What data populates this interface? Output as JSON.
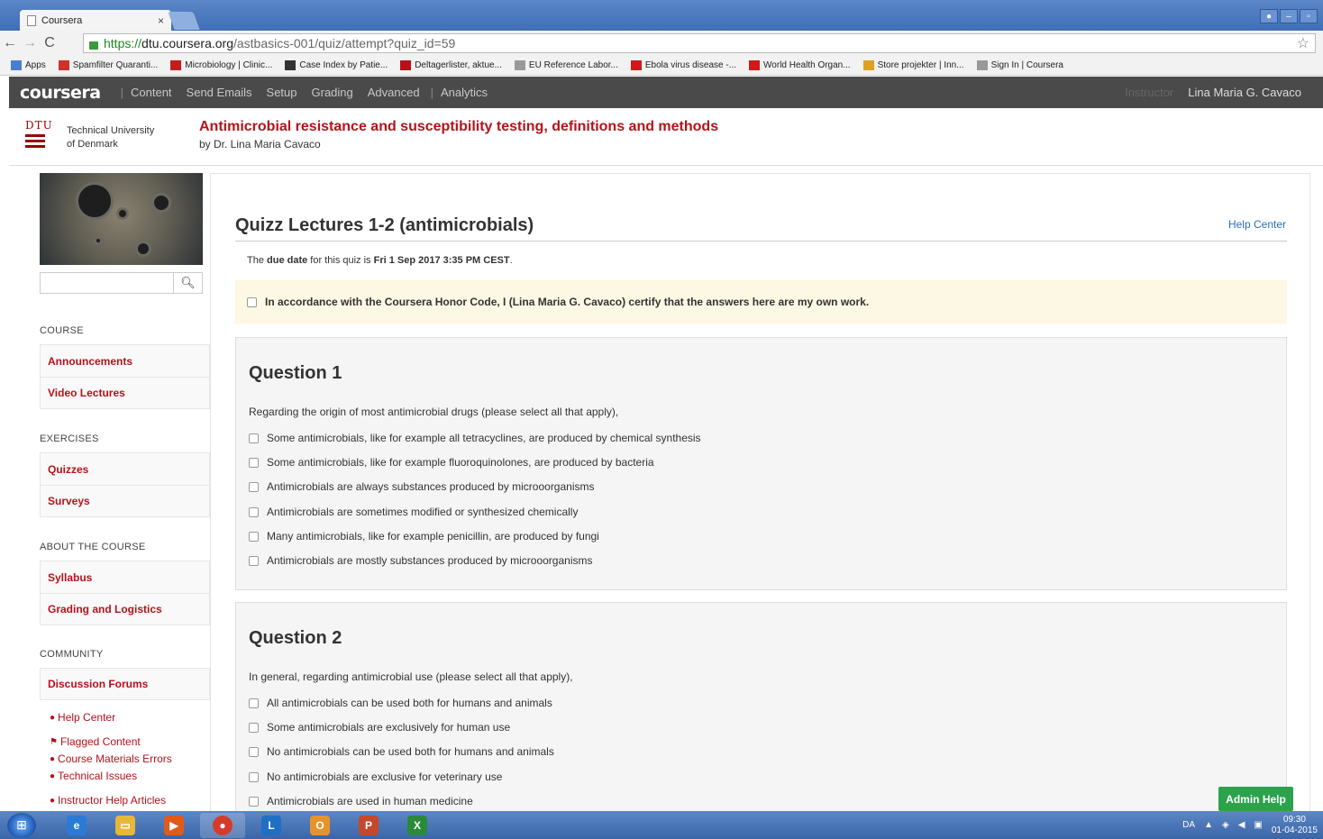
{
  "browser": {
    "tab_title": "Coursera",
    "tab_close": "×",
    "url_protocol": "https://",
    "url_host": "dtu.coursera.org",
    "url_path": "/astbasics-001/quiz/attempt?quiz_id=59",
    "bookmarks": [
      {
        "label": "Apps",
        "color": "#4a7fd0"
      },
      {
        "label": "Spamfilter Quaranti...",
        "color": "#d0302a"
      },
      {
        "label": "Microbiology | Clinic...",
        "color": "#c41d1d"
      },
      {
        "label": "Case Index by Patie...",
        "color": "#333333"
      },
      {
        "label": "Deltagerlister, aktue...",
        "color": "#b5121b"
      },
      {
        "label": "EU Reference Labor...",
        "color": "#999999"
      },
      {
        "label": "Ebola virus disease -...",
        "color": "#d01a1a"
      },
      {
        "label": "World Health Organ...",
        "color": "#d01a1a"
      },
      {
        "label": "Store projekter | Inn...",
        "color": "#e0a020"
      },
      {
        "label": "Sign In | Coursera",
        "color": "#999999"
      }
    ]
  },
  "nav": {
    "logo": "coursera",
    "sep": "|",
    "links": [
      "Content",
      "Send Emails",
      "Setup",
      "Grading",
      "Advanced"
    ],
    "analytics": "Analytics",
    "role": "Instructor",
    "user": "Lina Maria G. Cavaco"
  },
  "course": {
    "logo_text": "DTU",
    "uni_line1": "Technical University",
    "uni_line2": "of Denmark",
    "title": "Antimicrobial resistance and susceptibility testing, definitions and methods",
    "byline": "by Dr. Lina Maria Cavaco"
  },
  "sidebar": {
    "search_placeholder": "",
    "sections": [
      {
        "heading": "COURSE",
        "items": [
          "Announcements",
          "Video Lectures"
        ]
      },
      {
        "heading": "EXERCISES",
        "items": [
          "Quizzes",
          "Surveys"
        ]
      },
      {
        "heading": "ABOUT THE COURSE",
        "items": [
          "Syllabus",
          "Grading and Logistics"
        ]
      },
      {
        "heading": "COMMUNITY",
        "items": [
          "Discussion Forums"
        ]
      }
    ],
    "help_center": "Help Center",
    "flagged": "Flagged Content",
    "materials_errors": "Course Materials Errors",
    "tech_issues": "Technical Issues",
    "instructor_help": "Instructor Help Articles"
  },
  "quiz": {
    "title": "Quizz Lectures 1-2 (antimicrobials)",
    "help_center": "Help Center",
    "due_pre": "The ",
    "due_bold": "due date",
    "due_mid": " for this quiz is ",
    "due_date": "Fri 1 Sep 2017 3:35 PM CEST",
    "due_post": ".",
    "honor": "In accordance with the Coursera Honor Code, I (Lina Maria G. Cavaco) certify that the answers here are my own work.",
    "questions": [
      {
        "heading": "Question 1",
        "prompt": "Regarding the origin of most antimicrobial drugs (please select all that apply),",
        "options": [
          "Some antimicrobials, like for example all tetracyclines, are produced by chemical synthesis",
          "Some antimicrobials, like for example fluoroquinolones, are produced by bacteria",
          "Antimicrobials are always substances produced by microoorganisms",
          "Antimicrobials are sometimes modified or synthesized chemically",
          "Many antimicrobials, like for example penicillin, are produced by fungi",
          "Antimicrobials are mostly substances produced by microoorganisms"
        ]
      },
      {
        "heading": "Question 2",
        "prompt": "In general, regarding antimicrobial use (please select all that apply),",
        "options": [
          "All antimicrobials can be used both for humans and animals",
          "Some antimicrobials are exclusively for human use",
          "No antimicrobials can be used both for humans and animals",
          "No antimicrobials are exclusive for veterinary use",
          "Antimicrobials are used in human medicine"
        ]
      }
    ]
  },
  "admin_help": "Admin Help",
  "taskbar": {
    "lang": "DA",
    "time": "09:30",
    "date": "01-04-2015"
  }
}
